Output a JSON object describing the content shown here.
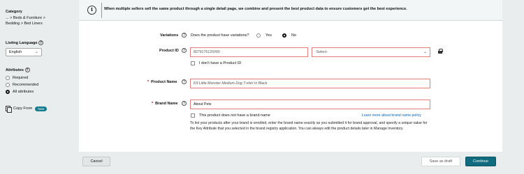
{
  "sidebar": {
    "category_title": "Category",
    "category_path_1": "... > Beds & Furniture >",
    "category_path_2": "Bedding > Bed Liners",
    "listing_language_title": "Listing Language",
    "language_value": "English",
    "attributes_title": "Attributes",
    "attribute_options": [
      {
        "label": "Required",
        "selected": false
      },
      {
        "label": "Recommended",
        "selected": false
      },
      {
        "label": "All attributes",
        "selected": true
      }
    ],
    "copy_from_label": "Copy From",
    "new_badge": "New"
  },
  "info_bar": {
    "icon": "i",
    "message": "When multiple sellers sell the same product through a single detail page, we combine and present the best product data to ensure customers get the best experience."
  },
  "form": {
    "variations": {
      "label": "Variations",
      "question": "Does the product have variations?",
      "options": [
        {
          "label": "Yes",
          "selected": false
        },
        {
          "label": "No",
          "selected": true
        }
      ]
    },
    "product_id": {
      "label": "Product ID",
      "value": "8279175125000",
      "type_placeholder": "-Select-",
      "no_id_checkbox_label": "I don't have a Product ID"
    },
    "product_name": {
      "required_marker": "*",
      "label": "Product Name",
      "value": "K9 Little Monster Medium Dog T-shirt In Black"
    },
    "brand_name": {
      "required_marker": "*",
      "label": "Brand Name",
      "value": "About Pets",
      "no_brand_checkbox_label": "This product does not have a brand name",
      "learn_more_link": "Learn more about brand name policy",
      "help_paragraph": "To list your products after your brand is enrolled, enter the brand name exactly as you submitted it for brand approval, and specify a unique value for the Key Attribute that you selected in the brand registry application. You can always edit the product details later in Manage Inventory."
    }
  },
  "footer": {
    "cancel": "Cancel",
    "save_draft": "Save as draft",
    "continue": "Continue"
  },
  "colors": {
    "accent": "#0f6b7d",
    "error_border": "#e47c7c",
    "link": "#0066c0"
  }
}
